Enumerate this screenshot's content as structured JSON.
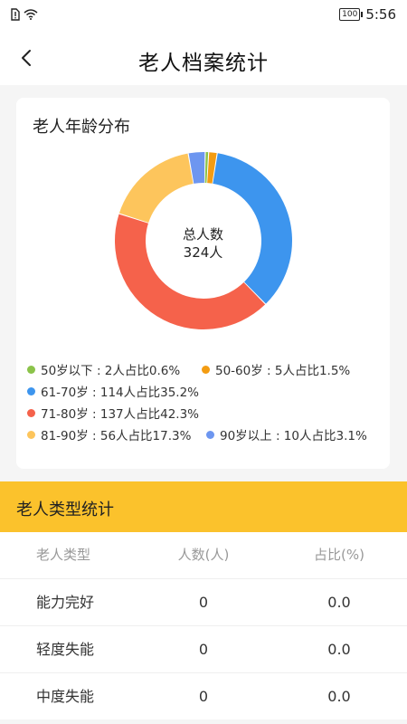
{
  "status": {
    "time": "5:56",
    "battery": "100"
  },
  "nav": {
    "title": "老人档案统计"
  },
  "age_card": {
    "title": "老人年龄分布",
    "center_line1": "总人数",
    "center_line2": "324人"
  },
  "chart_data": {
    "type": "pie",
    "categories": [
      "50岁以下",
      "50-60岁",
      "61-70岁",
      "71-80岁",
      "81-90岁",
      "90岁以上"
    ],
    "values": [
      2,
      5,
      114,
      137,
      56,
      10
    ],
    "percents": [
      0.6,
      1.5,
      35.2,
      42.3,
      17.3,
      3.1
    ],
    "colors": [
      "#8bc34a",
      "#f39c12",
      "#3d95ee",
      "#f5624b",
      "#fdc55c",
      "#6d96f0"
    ],
    "total": 324
  },
  "legend": [
    {
      "text": "50岁以下 : 2人占比0.6%",
      "color": "#8bc34a"
    },
    {
      "text": "50-60岁 : 5人占比1.5%",
      "color": "#f39c12"
    },
    {
      "text": "61-70岁 : 114人占比35.2%",
      "color": "#3d95ee"
    },
    {
      "text": "71-80岁 : 137人占比42.3%",
      "color": "#f5624b"
    },
    {
      "text": "81-90岁 : 56人占比17.3%",
      "color": "#fdc55c"
    },
    {
      "text": "90岁以上 : 10人占比3.1%",
      "color": "#6d96f0"
    }
  ],
  "type_section": {
    "title": "老人类型统计"
  },
  "type_table": {
    "headers": [
      "老人类型",
      "人数(人)",
      "占比(%)"
    ],
    "rows": [
      [
        "能力完好",
        "0",
        "0.0"
      ],
      [
        "轻度失能",
        "0",
        "0.0"
      ],
      [
        "中度失能",
        "0",
        "0.0"
      ]
    ]
  },
  "colors": {
    "accent": "#fbc22c",
    "background": "#f5f5f5"
  }
}
